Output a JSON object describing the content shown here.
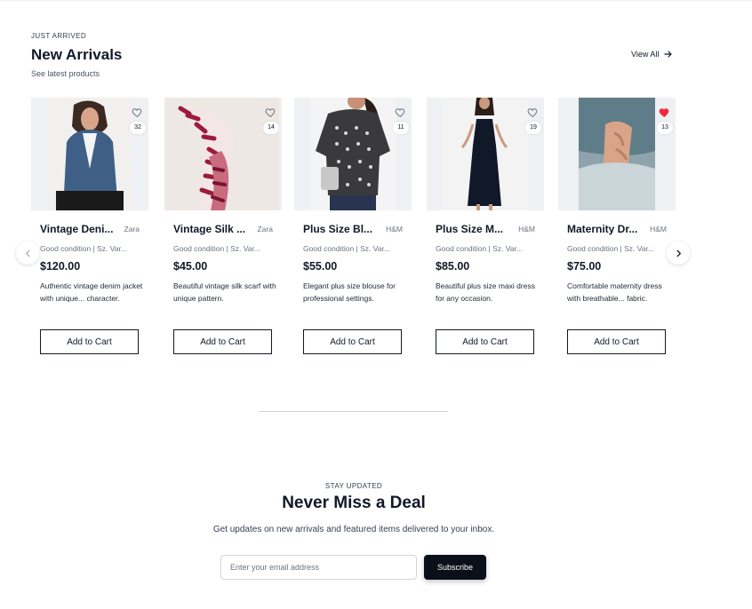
{
  "section": {
    "eyebrow": "JUST ARRIVED",
    "title": "New Arrivals",
    "subtitle": "See latest products",
    "view_all": "View All"
  },
  "products": [
    {
      "title": "Vintage Deni...",
      "brand": "Zara",
      "condition": "Good condition | Sz. Var...",
      "price": "$120.00",
      "description": "Authentic vintage denim jacket with unique... character.",
      "wishlist_count": "32",
      "wishlisted": false,
      "button": "Add to Cart",
      "image_icon": "denim-jacket-photo"
    },
    {
      "title": "Vintage Silk ...",
      "brand": "Zara",
      "condition": "Good condition | Sz. Var...",
      "price": "$45.00",
      "description": "Beautiful vintage silk scarf with unique pattern.",
      "wishlist_count": "14",
      "wishlisted": false,
      "button": "Add to Cart",
      "image_icon": "silk-scarf-photo"
    },
    {
      "title": "Plus Size Bl...",
      "brand": "H&M",
      "condition": "Good condition | Sz. Var...",
      "price": "$55.00",
      "description": "Elegant plus size blouse for professional settings.",
      "wishlist_count": "11",
      "wishlisted": false,
      "button": "Add to Cart",
      "image_icon": "blouse-photo"
    },
    {
      "title": "Plus Size M...",
      "brand": "H&M",
      "condition": "Good condition | Sz. Var...",
      "price": "$85.00",
      "description": "Beautiful plus size maxi dress for any occasion.",
      "wishlist_count": "19",
      "wishlisted": false,
      "button": "Add to Cart",
      "image_icon": "maxi-dress-photo"
    },
    {
      "title": "Maternity Dr...",
      "brand": "H&M",
      "condition": "Good condition | Sz. Var...",
      "price": "$75.00",
      "description": "Comfortable maternity dress with breathable... fabric.",
      "wishlist_count": "13",
      "wishlisted": true,
      "button": "Add to Cart",
      "image_icon": "maternity-dress-photo"
    }
  ],
  "carousel": {
    "prev_icon": "chevron-left-icon",
    "next_icon": "chevron-right-icon"
  },
  "newsletter": {
    "eyebrow": "STAY UPDATED",
    "title": "Never Miss a Deal",
    "description": "Get updates on new arrivals and featured items delivered to your inbox.",
    "email_placeholder": "Enter your email address",
    "email_value": "",
    "button": "Subscribe"
  },
  "colors": {
    "text": "#111827",
    "muted": "#6b7280",
    "wishlist_active": "#ef2b3c",
    "subscribe_bg": "#0b0f19"
  }
}
